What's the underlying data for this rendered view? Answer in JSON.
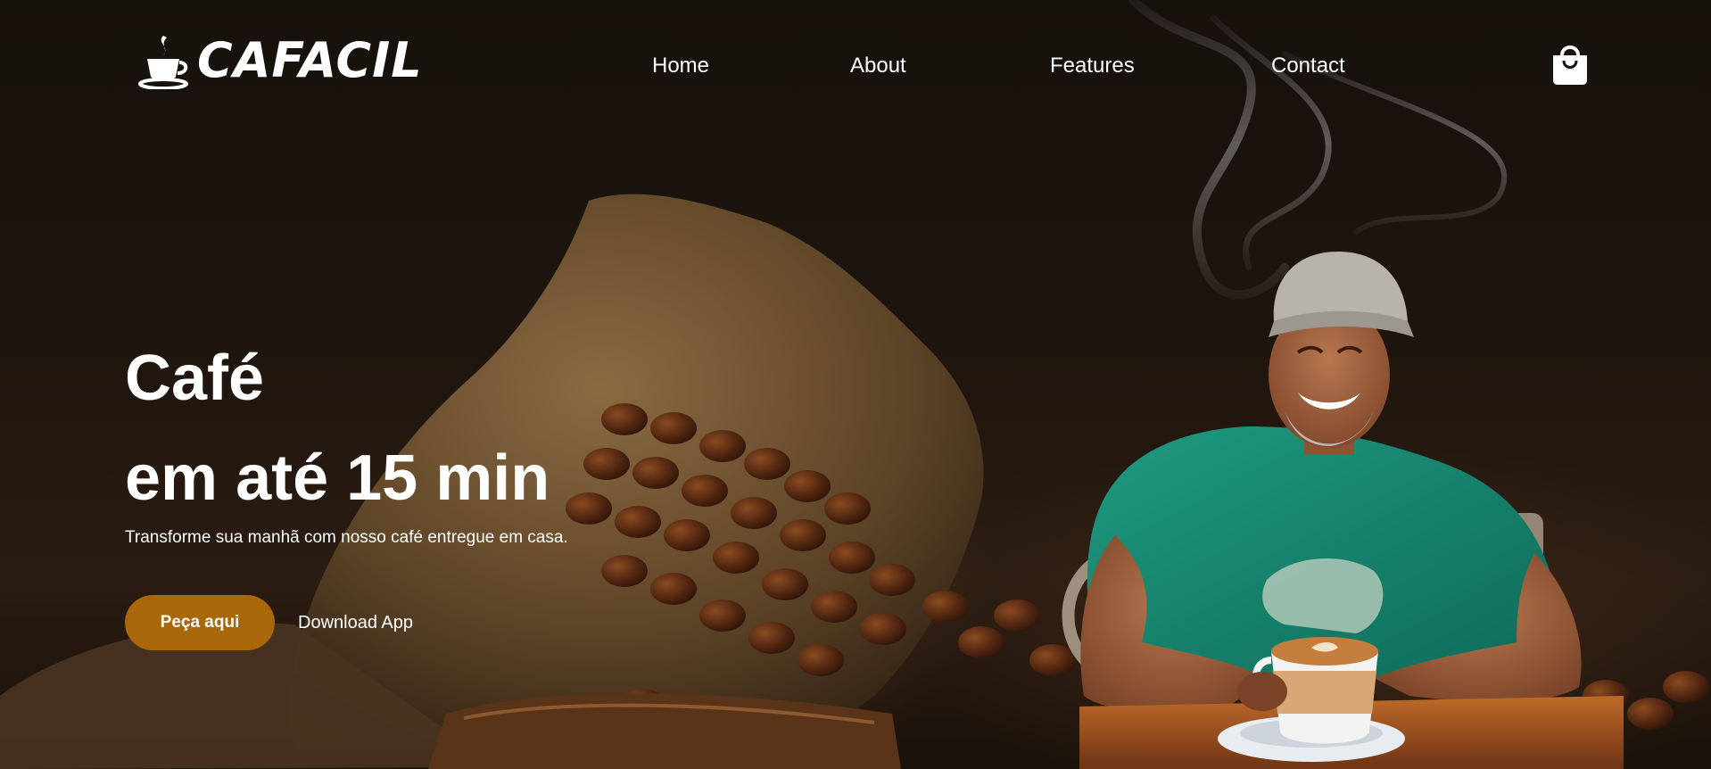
{
  "brand": {
    "logo_text": "CAFACIL",
    "logo_icon": "coffee-cup-icon"
  },
  "nav": {
    "items": [
      {
        "label": "Home"
      },
      {
        "label": "About"
      },
      {
        "label": "Features"
      },
      {
        "label": "Contact"
      }
    ],
    "cart_icon": "shopping-bag-icon"
  },
  "hero": {
    "headline_line1": "Café",
    "headline_line2": "em até 15 min",
    "subtitle": "Transforme sua manhã com nosso café entregue em casa.",
    "primary_button": "Peça aqui",
    "secondary_link": "Download App",
    "background_image": "coffee-beans-sack-and-smiling-man-with-cappuccino"
  },
  "colors": {
    "accent": "#a86709",
    "text": "#ffffff",
    "background": "#1a120b"
  }
}
